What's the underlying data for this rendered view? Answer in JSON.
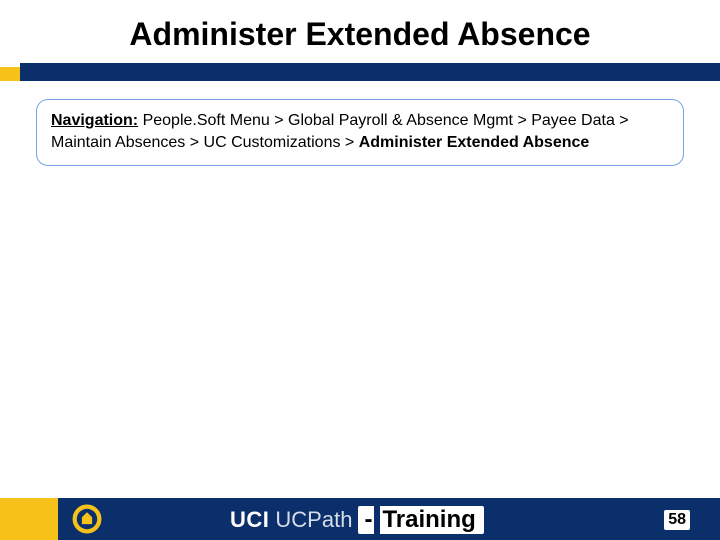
{
  "title": "Administer Extended Absence",
  "navigation": {
    "label": "Navigation:",
    "path_prefix": " People.Soft Menu > Global Payroll & Absence Mgmt > Payee Data > Maintain Absences > UC Customizations > ",
    "final": "Administer Extended Absence"
  },
  "footer": {
    "brand_primary": "UCI",
    "brand_secondary": "UCPath",
    "dash": "-",
    "training": "Training",
    "page_number": "58"
  },
  "colors": {
    "blue": "#0a2f6b",
    "gold": "#f6c21a"
  }
}
